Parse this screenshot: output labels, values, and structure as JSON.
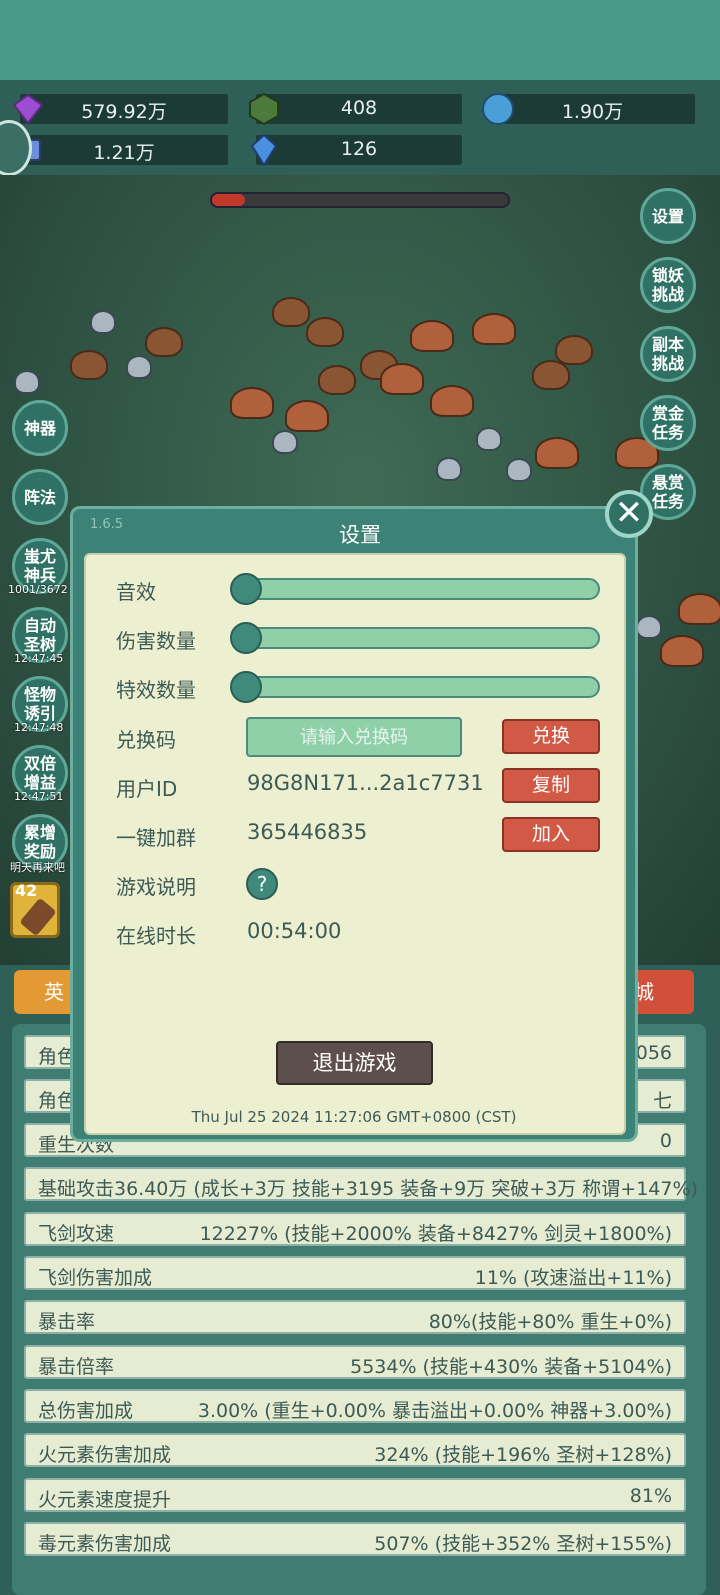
{
  "resources": [
    {
      "name": "gem-icon",
      "value": "579.92万",
      "color": "#9b4fd0"
    },
    {
      "name": "jade-icon",
      "value": "408",
      "color": "#4c7a3a"
    },
    {
      "name": "orb-icon",
      "value": "1.90万",
      "color": "#4a9fd8"
    },
    {
      "name": "scroll-icon",
      "value": "1.21万",
      "color": "#6c8fd8"
    },
    {
      "name": "crystal-icon",
      "value": "126",
      "color": "#4a8fe0"
    }
  ],
  "side_right": [
    "设置",
    "锁妖挑战",
    "副本挑战",
    "赏金任务",
    "悬赏任务"
  ],
  "side_left": [
    "神器",
    "阵法",
    "蚩尤神兵",
    "自动圣树",
    "怪物诱引",
    "双倍增益",
    "累增奖励"
  ],
  "side_left_sub": [
    "1001/3672",
    "12:47:45",
    "12:47:48",
    "12:47:51",
    "明天再来吧"
  ],
  "weapon_level": "42",
  "tabs": {
    "left": "英",
    "right": "城"
  },
  "stats": [
    {
      "label": "角色",
      "value": "056"
    },
    {
      "label": "角色",
      "value": "七"
    },
    {
      "label": "重生次数",
      "value": "0"
    },
    {
      "label": "基础攻击36.40万 (成长+3万 技能+3195 装备+9万 突破+3万 称谓+147%)",
      "value": ""
    },
    {
      "label": "飞剑攻速",
      "value": "12227% (技能+2000% 装备+8427% 剑灵+1800%)"
    },
    {
      "label": "飞剑伤害加成",
      "value": "11% (攻速溢出+11%)"
    },
    {
      "label": "暴击率",
      "value": "80%(技能+80% 重生+0%)"
    },
    {
      "label": "暴击倍率",
      "value": "5534% (技能+430% 装备+5104%)"
    },
    {
      "label": "总伤害加成",
      "value": "3.00% (重生+0.00% 暴击溢出+0.00% 神器+3.00%)"
    },
    {
      "label": "火元素伤害加成",
      "value": "324% (技能+196% 圣树+128%)"
    },
    {
      "label": "火元素速度提升",
      "value": "81%"
    },
    {
      "label": "毒元素伤害加成",
      "value": "507% (技能+352% 圣树+155%)"
    }
  ],
  "dialog": {
    "version": "1.6.5",
    "title": "设置",
    "close_label": "✕",
    "sound_label": "音效",
    "damage_count_label": "伤害数量",
    "effect_count_label": "特效数量",
    "sound_level": 0,
    "damage_count_level": 0,
    "effect_count_level": 0,
    "redeem_label": "兑换码",
    "redeem_placeholder": "请输入兑换码",
    "redeem_button": "兑换",
    "user_id_label": "用户ID",
    "user_id_value": "98G8N171...2a1c7731",
    "copy_button": "复制",
    "join_group_label": "一键加群",
    "join_group_value": "365446835",
    "join_button": "加入",
    "guide_label": "游戏说明",
    "guide_button": "?",
    "online_label": "在线时长",
    "online_value": "00:54:00",
    "exit_button": "退出游戏",
    "timestamp": "Thu Jul 25 2024 11:27:06 GMT+0800 (CST)"
  }
}
